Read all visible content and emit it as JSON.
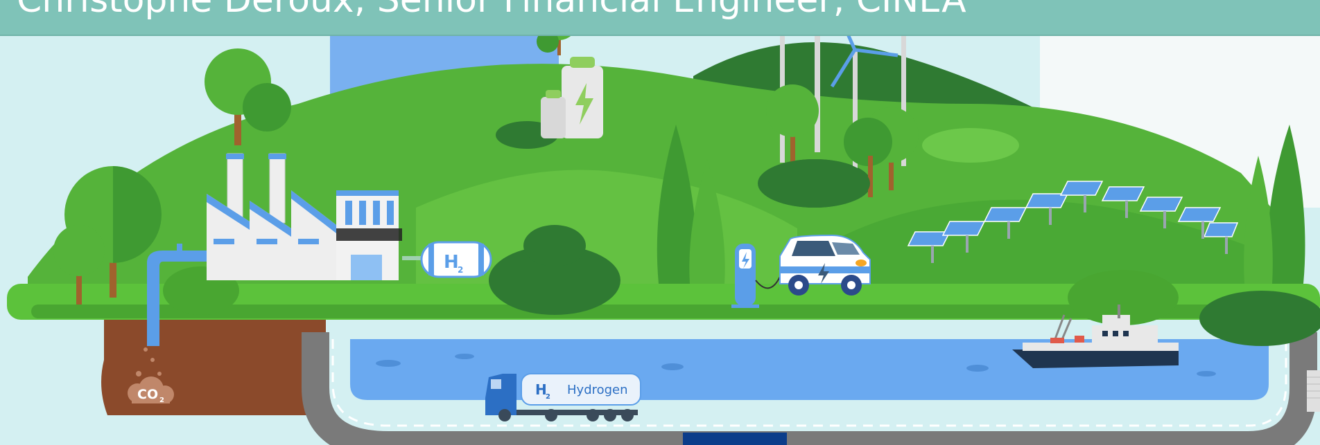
{
  "title": "Christophe Deroux, Senior Financial Engineer, CINEA",
  "labels": {
    "co2": "CO",
    "co2_sub": "2",
    "tank_h": "H",
    "tank_sub": "2",
    "truck_h": "H",
    "truck_sub": "2",
    "truck_word": "Hydrogen"
  },
  "colors": {
    "sky": "#cfeff2",
    "hill_light": "#55b33a",
    "hill_dark": "#2f7a32",
    "soil": "#8b4a2b",
    "water": "#6aa9f0",
    "road": "#7a7a7a",
    "title_bar": "#7fc3b8"
  }
}
